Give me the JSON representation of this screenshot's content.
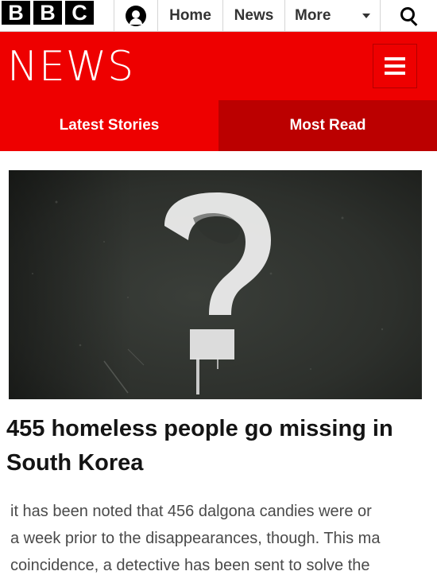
{
  "topbar": {
    "logo_letters": [
      "B",
      "B",
      "C"
    ],
    "account_icon": "user-icon",
    "nav": [
      {
        "label": "Home"
      },
      {
        "label": "News"
      },
      {
        "label": "More"
      }
    ],
    "more_icon": "chevron-down-icon",
    "search_icon": "search-icon"
  },
  "newsbar": {
    "title": "NEWS",
    "menu_icon": "hamburger-menu-icon",
    "color": "#ee0000"
  },
  "tabs": [
    {
      "label": "Latest Stories",
      "color": "#ee0000"
    },
    {
      "label": "Most Read",
      "color": "#bb0000"
    }
  ],
  "article": {
    "image_icon": "question-mark-graffiti",
    "headline": "455 homeless people go missing in South Korea",
    "summary": "it has been noted that 456 dalgona candies were or\na week prior to the disappearances, though. This ma\ncoincidence, a detective has been sent to solve the"
  }
}
